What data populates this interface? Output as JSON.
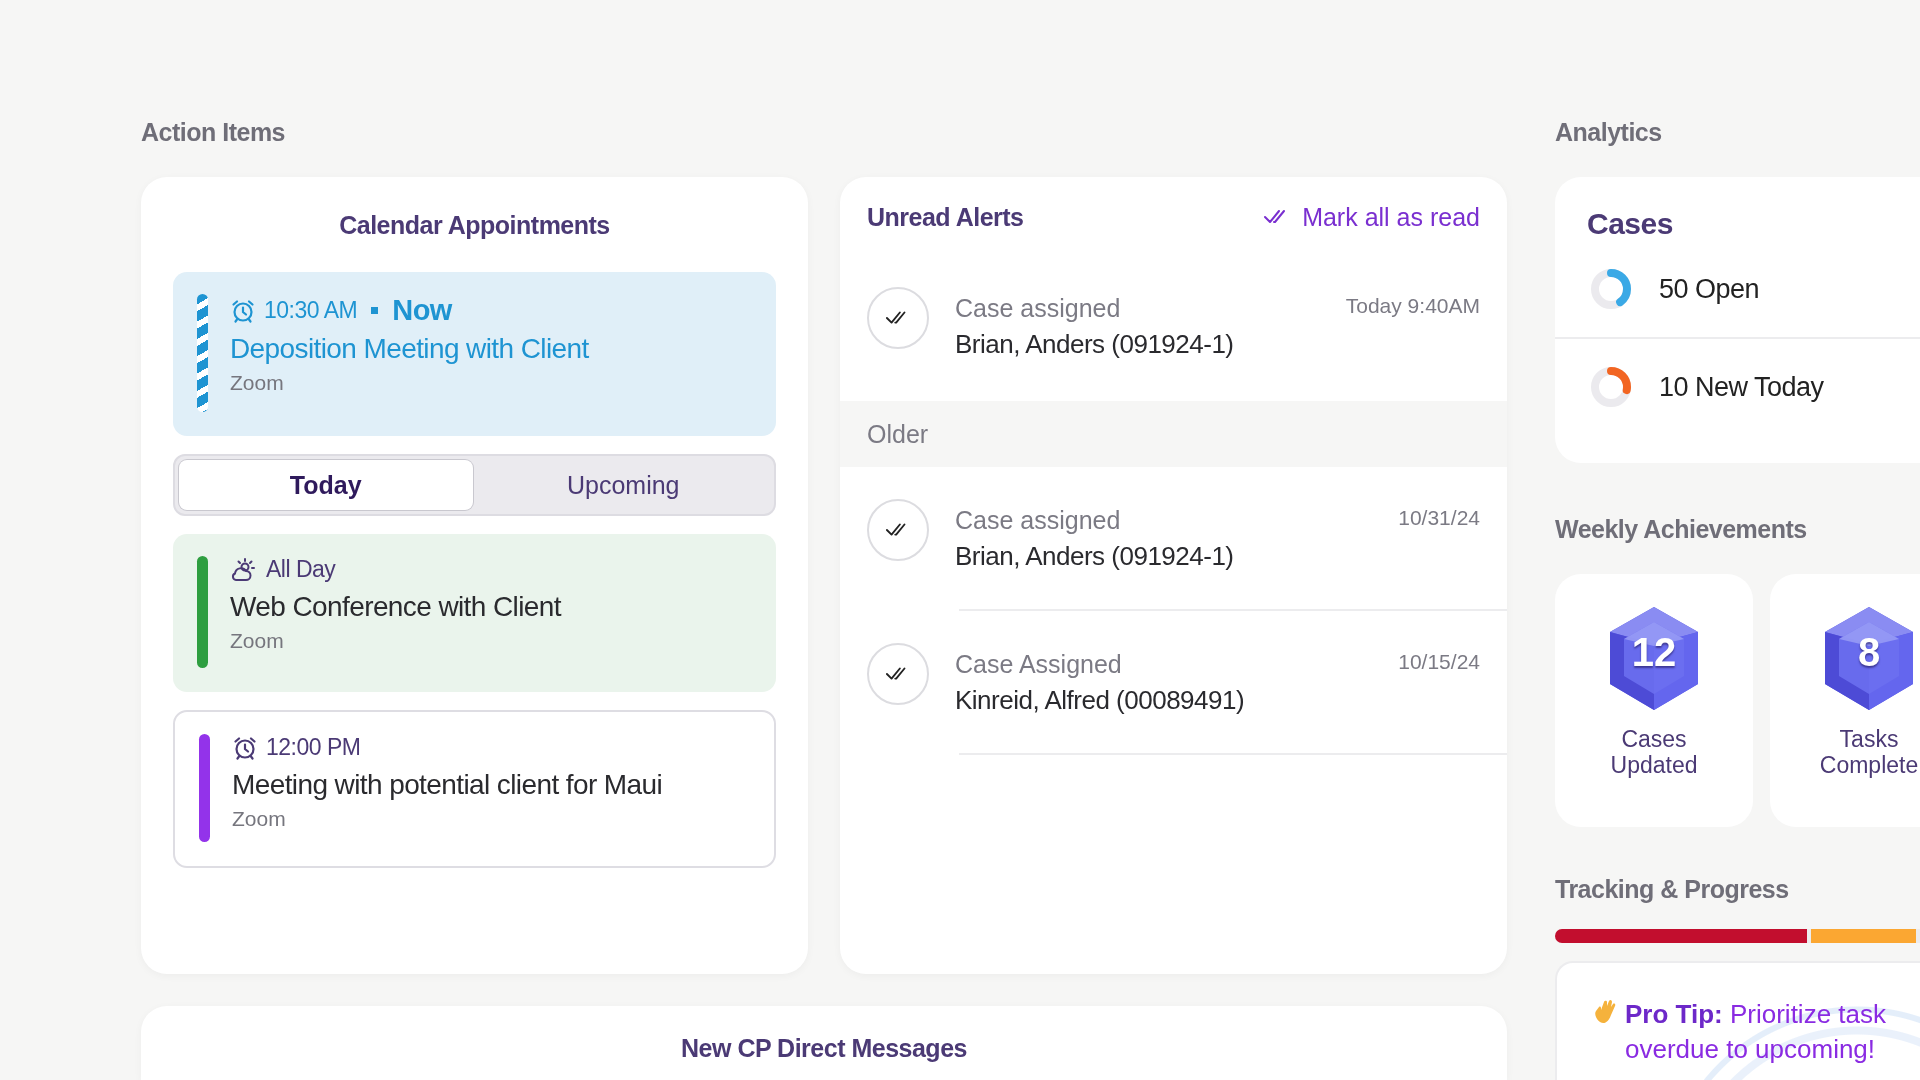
{
  "action_items": {
    "heading": "Action Items",
    "calendar": {
      "title": "Calendar Appointments",
      "current_event": {
        "kind": "current",
        "time": "10:30 AM",
        "status": "Now",
        "title": "Deposition Meeting with Client",
        "location": "Zoom",
        "color": "#1e94d2"
      },
      "tabs": [
        {
          "label": "Today",
          "selected": true
        },
        {
          "label": "Upcoming",
          "selected": false
        }
      ],
      "events": [
        {
          "kind": "allday",
          "time": "All Day",
          "title": "Web Conference with Client",
          "location": "Zoom",
          "color": "#2e9e40"
        },
        {
          "kind": "timed",
          "time": "12:00 PM",
          "title": "Meeting with potential client for Maui",
          "location": "Zoom",
          "color": "#9333ea"
        }
      ]
    },
    "alerts": {
      "title": "Unread Alerts",
      "mark_all": "Mark all as read",
      "unread": [
        {
          "type": "Case assigned",
          "name": "Brian, Anders (091924-1)",
          "date": "Today 9:40AM"
        }
      ],
      "older_label": "Older",
      "older": [
        {
          "type": "Case assigned",
          "name": "Brian, Anders (091924-1)",
          "date": "10/31/24"
        },
        {
          "type": "Case Assigned",
          "name": "Kinreid, Alfred  (00089491)",
          "date": "10/15/24"
        }
      ]
    },
    "messages": {
      "title": "New CP Direct Messages"
    }
  },
  "analytics": {
    "heading": "Analytics",
    "cases": {
      "title": "Cases",
      "stats": [
        {
          "label": "50 Open",
          "level": 0.4,
          "color": "#3aa9e6"
        },
        {
          "label": "10 New Today",
          "level": 0.28,
          "color": "#f26522"
        }
      ]
    },
    "achievements_heading": "Weekly Achievements",
    "achievements": [
      {
        "count": "12",
        "label": "Cases Updated"
      },
      {
        "count": "8",
        "label": "Tasks Complete"
      }
    ],
    "tracking_heading": "Tracking & Progress",
    "progress": [
      {
        "level": 0.7,
        "color": "#c20e2e"
      },
      {
        "level": 0.3,
        "color": "#fba732"
      }
    ],
    "pro_tip": {
      "lines": [
        "**Pro Tip:**  Prioritize task",
        "overdue to upcoming!"
      ]
    }
  }
}
